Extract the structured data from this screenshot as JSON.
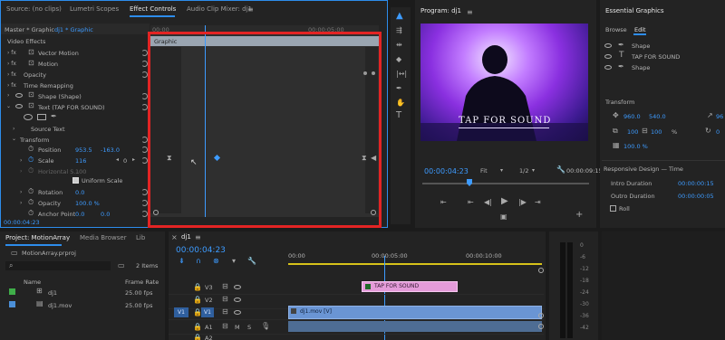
{
  "source_panel": {
    "tabs": [
      "Source: (no clips)",
      "Lumetri Scopes",
      "Effect Controls",
      "Audio Clip Mixer: dj1"
    ],
    "master_label": "Master * Graphic",
    "clip_label": "dj1 * Graphic",
    "section_video_effects": "Video Effects",
    "effects": [
      "Vector Motion",
      "Motion",
      "Opacity",
      "Time Remapping",
      "Shape (Shape)",
      "Text (TAP FOR SOUND)"
    ],
    "source_text": "Source Text",
    "transform": "Transform",
    "position_label": "Position",
    "position_x": "953.5",
    "position_y": "-163.0",
    "scale_label": "Scale",
    "scale_value": "116",
    "scale_keyframe_count": "0",
    "hscale_label": "Horizontal S...",
    "hscale_value": "100",
    "uniform_scale": "Uniform Scale",
    "rotation_label": "Rotation",
    "rotation_value": "0.0",
    "opacity_label": "Opacity",
    "opacity_value": "100.0 %",
    "anchor_label": "Anchor Point",
    "anchor_x": "0.0",
    "anchor_y": "0.0",
    "timecode": "00:00:04:23",
    "clip_bar_label": "Graphic",
    "ruler_labels": [
      "00:00",
      "00:00:05:00"
    ]
  },
  "program": {
    "title": "Program: dj1",
    "overlay_text": "TAP FOR SOUND",
    "timecode": "00:00:04:23",
    "fit": "Fit",
    "resolution": "1/2",
    "duration": "00:00:09:15"
  },
  "essential_graphics": {
    "title": "Essential Graphics",
    "tabs": [
      "Browse",
      "Edit"
    ],
    "layers": [
      "Shape",
      "TAP FOR SOUND",
      "Shape"
    ],
    "transform_title": "Transform",
    "pos_x": "960.0",
    "pos_y": "540.0",
    "rot": "96",
    "scale_w": "100",
    "scale_h": "100",
    "scale_unit": "%",
    "angle": "0",
    "opacity": "100.0 %",
    "responsive_title": "Responsive Design — Time",
    "intro_label": "Intro Duration",
    "intro_value": "00:00:00:15",
    "outro_label": "Outro Duration",
    "outro_value": "00:00:00:05",
    "roll_label": "Roll"
  },
  "project": {
    "tabs": [
      "Project: MotionArray",
      "Media Browser",
      "Lib"
    ],
    "file": "MotionArray.prproj",
    "items_count": "2 Items",
    "col_name": "Name",
    "col_rate": "Frame Rate",
    "rows": [
      {
        "name": "dj1",
        "rate": "25.00 fps",
        "color": "#3fae49"
      },
      {
        "name": "dj1.mov",
        "rate": "25.00 fps",
        "color": "#4b8fd8"
      }
    ]
  },
  "timeline": {
    "tab": "dj1",
    "timecode": "00:00:04:23",
    "ruler": [
      "00:00",
      "00:00:05:00",
      "00:00:10:00"
    ],
    "tracks": [
      "V3",
      "V2",
      "V1",
      "A1",
      "A2"
    ],
    "src_patch": "V1",
    "graphic_clip": "TAP FOR SOUND",
    "video_clip": "dj1.mov [V]"
  },
  "meter_labels": [
    "0",
    "-6",
    "-12",
    "-18",
    "-24",
    "-30",
    "-36",
    "-42"
  ]
}
